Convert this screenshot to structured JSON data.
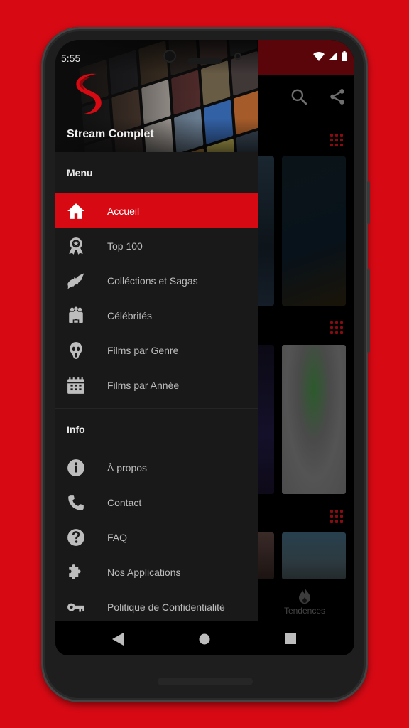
{
  "status_bar": {
    "time": "5:55"
  },
  "drawer": {
    "app_name": "Stream Complet",
    "sections": [
      {
        "title": "Menu",
        "items": [
          {
            "label": "Accueil",
            "icon": "home-icon",
            "active": true
          },
          {
            "label": "Top 100",
            "icon": "award-badge-icon",
            "active": false
          },
          {
            "label": "Colléctions et Sagas",
            "icon": "bat-icon",
            "active": false
          },
          {
            "label": "Célébrités",
            "icon": "people-group-icon",
            "active": false
          },
          {
            "label": "Films par Genre",
            "icon": "scream-mask-icon",
            "active": false
          },
          {
            "label": "Films par Année",
            "icon": "calendar-icon",
            "active": false
          }
        ]
      },
      {
        "title": "Info",
        "items": [
          {
            "label": "À propos",
            "icon": "info-icon"
          },
          {
            "label": "Contact",
            "icon": "phone-icon"
          },
          {
            "label": "FAQ",
            "icon": "help-icon"
          },
          {
            "label": "Nos Applications",
            "icon": "puzzle-icon"
          },
          {
            "label": "Politique de Confidentialité",
            "icon": "key-icon"
          }
        ]
      }
    ]
  },
  "background_app": {
    "bottom_tab_label": "Tendences",
    "bottom_tab_icon": "fire-icon",
    "app_bar_icons": [
      "search-icon",
      "share-icon"
    ]
  },
  "colors": {
    "brand": "#d70a14",
    "drawer_bg": "#191919",
    "status_bar_bg": "#5a0509"
  }
}
